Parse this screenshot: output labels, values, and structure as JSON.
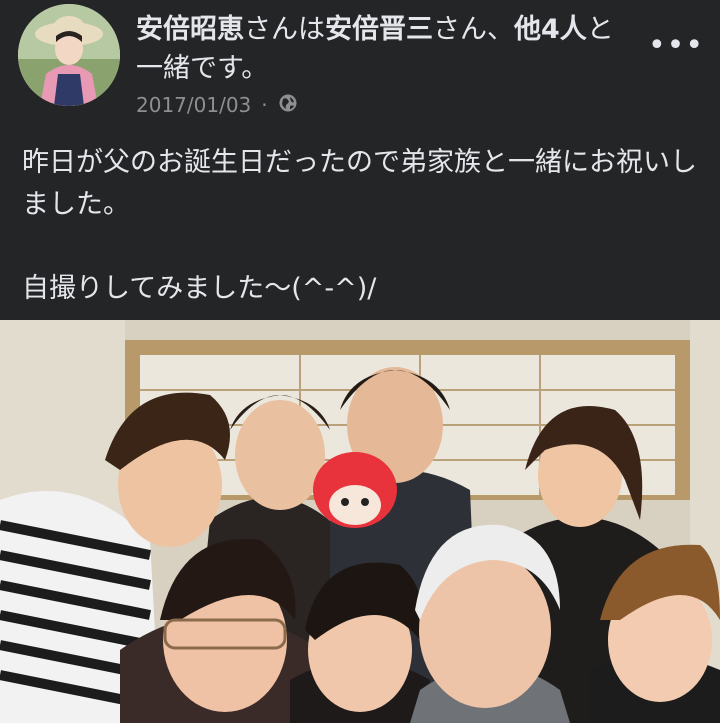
{
  "post": {
    "author_name": "安倍昭恵",
    "connector1": "さんは",
    "tagged_main": "安倍晋三",
    "connector2": "さん、",
    "others": "他4人",
    "suffix": "と一緒です。",
    "date": "2017/01/03",
    "separator": "·",
    "privacy_icon": "globe-icon",
    "more_icon": "more-horizontal-icon",
    "more_label": "•••",
    "text": "昨日が父のお誕生日だったので弟家族と一緒にお祝いしました。\n\n自撮りしてみました〜(^-^)/"
  },
  "colors": {
    "background": "#242526",
    "text": "#e4e6eb",
    "secondary_text": "#8d8f93"
  }
}
